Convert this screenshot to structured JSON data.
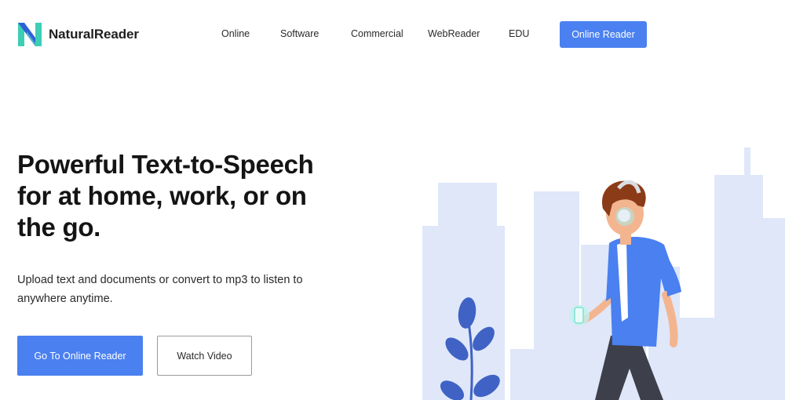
{
  "header": {
    "brand": "NaturalReader",
    "nav": [
      {
        "label": "Online"
      },
      {
        "label": "Software"
      },
      {
        "label": "Commercial"
      },
      {
        "label": "WebReader"
      },
      {
        "label": "EDU"
      }
    ],
    "cta_label": "Online Reader"
  },
  "hero": {
    "title": "Powerful Text-to-Speech for at home, work, or on the go.",
    "subtitle": "Upload text and documents or convert to mp3 to listen to anywhere anytime.",
    "primary_button": "Go To Online Reader",
    "secondary_button": "Watch Video"
  },
  "icons": {
    "logo": "naturalreader-logo-icon",
    "illustration": "person-listening-illustration"
  },
  "colors": {
    "accent": "#4a80f0",
    "logo_teal": "#3ccfb4",
    "logo_blue": "#2d62d6",
    "skyline": "#dfe7f9",
    "plant": "#3f62c4"
  }
}
